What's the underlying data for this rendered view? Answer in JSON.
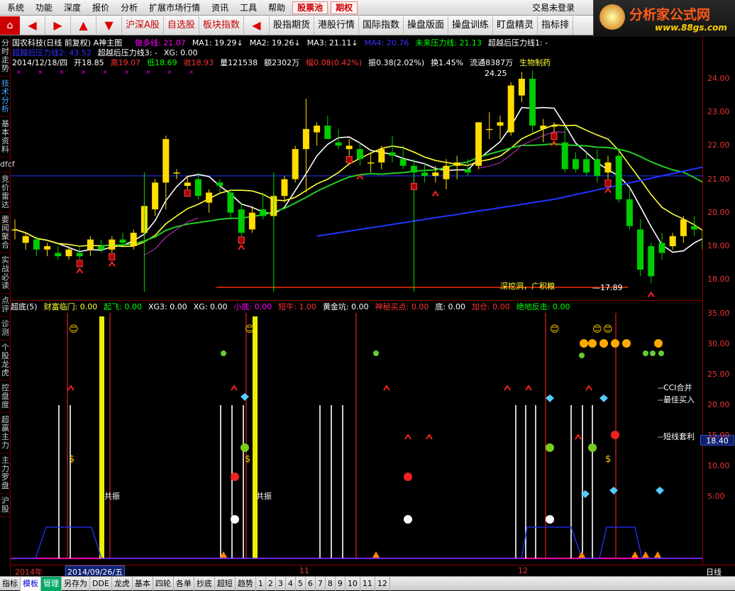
{
  "menu": {
    "items": [
      "系统",
      "功能",
      "深度",
      "报价",
      "分析",
      "扩展市场行情",
      "资讯",
      "工具",
      "帮助"
    ],
    "stock_pool": "股票池",
    "futures": "期权",
    "trade_status": "交易未登录"
  },
  "brand": {
    "title": "分析家公式网",
    "url": "www.88gs.com"
  },
  "toolbar": {
    "tabs": [
      "沪深A股",
      "自选股",
      "板块指数"
    ],
    "tabs2": [
      "股指期货",
      "港股行情",
      "国际指数",
      "操盘版面",
      "操盘训练",
      "盯盘精灵",
      "指标排"
    ]
  },
  "leftbar": {
    "items": [
      "分时走势",
      "技术分析",
      "基本资料",
      "dfcf",
      "竞价雷达",
      "要闻聚合",
      "实战必读",
      "点评",
      "诊测",
      "个股龙虎",
      "控盘度",
      "超赢主力",
      "主力罗盘",
      "沪股"
    ]
  },
  "header": {
    "title": "国农科技(日线 前复权) A神主图",
    "line1": [
      {
        "t": "做多线: 21.07",
        "c": "m"
      },
      {
        "t": "MA1: 19.29↓",
        "c": "w"
      },
      {
        "t": "MA2: 19.26↓",
        "c": "w"
      },
      {
        "t": "MA3: 21.11↓",
        "c": "w"
      },
      {
        "t": "MA4: 20.76",
        "c": "b"
      },
      {
        "t": "未来压力线: 21.13",
        "c": "g"
      },
      {
        "t": "超越后压力线1: -",
        "c": "w"
      }
    ],
    "line2": [
      {
        "t": "超越后压力线2: 43.52",
        "c": "b"
      },
      {
        "t": "超越后压力线3: -",
        "c": "w"
      },
      {
        "t": "XG: 0.00",
        "c": "w"
      }
    ],
    "line3": [
      {
        "t": "2014/12/18/四",
        "c": "w"
      },
      {
        "t": "开18.85",
        "c": "w"
      },
      {
        "t": "高19.07",
        "c": "r"
      },
      {
        "t": "低18.69",
        "c": "g"
      },
      {
        "t": "收18.93",
        "c": "r"
      },
      {
        "t": "量121538",
        "c": "w"
      },
      {
        "t": "额2302万",
        "c": "w"
      },
      {
        "t": "幅0.08(0.42%)",
        "c": "r"
      },
      {
        "t": "振0.38(2.02%)",
        "c": "w"
      },
      {
        "t": "换1.45%",
        "c": "w"
      },
      {
        "t": "流通8387万",
        "c": "w"
      },
      {
        "t": "生物制药",
        "c": "y"
      }
    ]
  },
  "annotations": {
    "high": "24.25",
    "low": "17.89",
    "dig": "深挖洞，广积粮",
    "cci": "--CCI合并",
    "best": "--最佳买入",
    "short": "--短线套利",
    "resonance": "共振"
  },
  "indicator": [
    {
      "t": "超底(5)",
      "c": "w"
    },
    {
      "t": "财富临门: 0.00",
      "c": "y"
    },
    {
      "t": "起飞: 0.00",
      "c": "g"
    },
    {
      "t": "XG3: 0.00",
      "c": "w"
    },
    {
      "t": "XG: 0.00",
      "c": "w"
    },
    {
      "t": "小底: 0.00",
      "c": "m"
    },
    {
      "t": "短牛: 1.00",
      "c": "r"
    },
    {
      "t": "黄金坑: 0.00",
      "c": "w"
    },
    {
      "t": "神秘买点: 0.00",
      "c": "r"
    },
    {
      "t": "底: 0.00",
      "c": "w"
    },
    {
      "t": "加仓: 0.00",
      "c": "r"
    },
    {
      "t": "绝地反击: 0.00",
      "c": "g"
    }
  ],
  "axis": {
    "top": [
      "24.00",
      "23.00",
      "22.00",
      "21.00",
      "20.00",
      "19.00",
      "18.00"
    ],
    "bottom": [
      "35.00",
      "30.00",
      "25.00",
      "20.00",
      "15.00",
      "10.00",
      "5.00"
    ],
    "current": "18.40",
    "period": "日线"
  },
  "dates": {
    "year": "2014年",
    "cursor": "2014/09/26/五",
    "m11": "11",
    "m12": "12"
  },
  "bottom": [
    "指标",
    "模板",
    "管理",
    "另存为",
    "DDE",
    "龙虎",
    "基本",
    "四轮",
    "各单",
    "抄底",
    "超短",
    "趋势",
    "1",
    "2",
    "3",
    "4",
    "5",
    "6",
    "7",
    "8",
    "9",
    "10",
    "11",
    "12"
  ],
  "chart_data": {
    "type": "candlestick",
    "title": "国农科技(日线 前复权) A神主图",
    "ylim": [
      17.7,
      24.4
    ],
    "candles": [
      [
        19.5,
        19.8,
        19.2,
        19.5
      ],
      [
        19.1,
        19.4,
        18.9,
        19.3
      ],
      [
        19.2,
        19.3,
        18.7,
        18.9
      ],
      [
        18.9,
        19.1,
        18.7,
        19.0
      ],
      [
        18.8,
        19.0,
        18.6,
        18.7
      ],
      [
        18.7,
        19.0,
        18.6,
        18.9
      ],
      [
        18.8,
        19.0,
        18.6,
        18.7
      ],
      [
        18.9,
        19.3,
        18.7,
        19.2
      ],
      [
        19.0,
        19.2,
        18.8,
        18.9
      ],
      [
        18.9,
        19.3,
        18.8,
        19.2
      ],
      [
        19.2,
        19.4,
        19.0,
        19.1
      ],
      [
        19.0,
        19.5,
        18.9,
        19.4
      ],
      [
        19.4,
        20.3,
        19.2,
        20.2
      ],
      [
        20.1,
        21.0,
        19.9,
        20.9
      ],
      [
        20.9,
        22.3,
        20.1,
        22.2
      ],
      [
        21.2,
        21.3,
        21.0,
        21.2
      ],
      [
        20.8,
        21.1,
        20.7,
        20.9
      ],
      [
        21.0,
        21.2,
        20.4,
        20.5
      ],
      [
        20.3,
        20.7,
        20.0,
        20.6
      ],
      [
        20.9,
        21.0,
        20.6,
        20.8
      ],
      [
        20.6,
        20.7,
        19.8,
        20.0
      ],
      [
        20.1,
        20.3,
        19.3,
        19.4
      ],
      [
        19.5,
        20.2,
        19.4,
        20.0
      ],
      [
        20.1,
        20.6,
        19.8,
        19.9
      ],
      [
        19.9,
        20.6,
        19.8,
        20.5
      ],
      [
        20.5,
        21.1,
        20.3,
        21.0
      ],
      [
        21.0,
        22.0,
        20.9,
        21.9
      ],
      [
        21.9,
        23.4,
        20.6,
        22.5
      ],
      [
        22.4,
        22.7,
        22.0,
        22.6
      ],
      [
        22.6,
        22.9,
        22.2,
        22.2
      ],
      [
        22.1,
        22.5,
        21.9,
        22.0
      ],
      [
        21.9,
        22.2,
        21.7,
        22.0
      ],
      [
        21.9,
        22.1,
        21.4,
        21.6
      ],
      [
        21.5,
        21.8,
        21.2,
        21.5
      ],
      [
        21.5,
        22.0,
        21.3,
        21.9
      ],
      [
        21.8,
        22.3,
        21.5,
        21.7
      ],
      [
        21.6,
        22.0,
        21.3,
        21.4
      ],
      [
        21.4,
        21.6,
        20.9,
        21.2
      ],
      [
        21.2,
        21.5,
        20.9,
        21.1
      ],
      [
        21.1,
        21.4,
        20.9,
        21.2
      ],
      [
        21.0,
        21.6,
        20.7,
        21.4
      ],
      [
        21.4,
        21.7,
        21.0,
        21.5
      ],
      [
        21.3,
        21.6,
        21.1,
        21.2
      ],
      [
        21.4,
        22.7,
        21.3,
        22.7
      ],
      [
        22.5,
        23.0,
        22.2,
        22.5
      ],
      [
        22.6,
        22.9,
        22.2,
        22.7
      ],
      [
        22.4,
        23.9,
        22.3,
        23.8
      ],
      [
        23.5,
        24.2,
        23.3,
        24.0
      ],
      [
        24.0,
        24.25,
        22.4,
        22.6
      ],
      [
        22.5,
        22.8,
        22.1,
        22.6
      ],
      [
        22.6,
        22.7,
        22.4,
        22.6
      ],
      [
        22.1,
        22.6,
        21.2,
        21.3
      ],
      [
        21.6,
        21.8,
        21.2,
        21.3
      ],
      [
        21.6,
        21.8,
        21.1,
        21.2
      ],
      [
        21.6,
        21.9,
        20.9,
        21.1
      ],
      [
        21.2,
        21.7,
        21.0,
        21.5
      ],
      [
        21.7,
        21.9,
        20.3,
        20.4
      ],
      [
        20.4,
        20.7,
        19.5,
        19.6
      ],
      [
        19.5,
        19.8,
        18.1,
        18.3
      ],
      [
        19.0,
        19.1,
        17.89,
        18.1
      ],
      [
        19.1,
        19.4,
        18.6,
        18.8
      ],
      [
        19.0,
        19.4,
        18.9,
        19.3
      ],
      [
        19.3,
        19.9,
        19.1,
        19.8
      ],
      [
        19.6,
        19.9,
        19.3,
        19.5
      ],
      [
        19.5,
        19.8,
        18.6,
        18.9
      ],
      [
        18.85,
        19.07,
        18.69,
        18.93
      ]
    ]
  }
}
